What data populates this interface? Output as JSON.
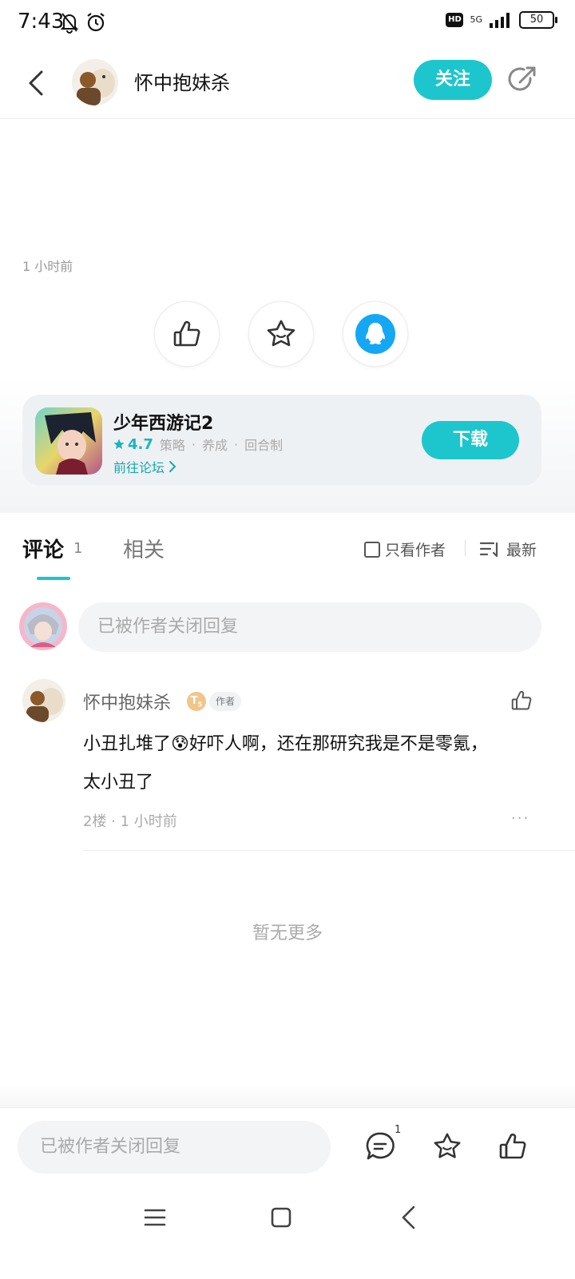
{
  "status_bar": {
    "time": "7:43",
    "network": "5G",
    "battery": "50",
    "hd": "HD"
  },
  "header": {
    "username": "怀中抱妹杀",
    "follow_label": "关注"
  },
  "post": {
    "timestamp": "1 小时前"
  },
  "game_card": {
    "title": "少年西游记2",
    "rating": "4.7",
    "tags": [
      "策略",
      "养成",
      "回合制"
    ],
    "forum_link": "前往论坛",
    "download_label": "下载"
  },
  "tabs": {
    "comments_label": "评论",
    "comments_count": "1",
    "related_label": "相关",
    "author_only_label": "只看作者",
    "sort_label": "最新"
  },
  "reply": {
    "placeholder": "已被作者关闭回复"
  },
  "comments": [
    {
      "author": "怀中抱妹杀",
      "level": "T",
      "level_num": "5",
      "author_tag": "作者",
      "text_lines": [
        "小丑扎堆了😰好吓人啊，还在那研究我是不是零氪，",
        "太小丑了"
      ],
      "meta": "2楼 · 1 小时前",
      "more": "···"
    }
  ],
  "footer": {
    "no_more": "暂无更多"
  },
  "bottom_bar": {
    "placeholder": "已被作者关闭回复",
    "comment_count": "1"
  },
  "colors": {
    "accent": "#1cc6cc",
    "link": "#12a8b3",
    "text": "#111111",
    "muted": "#aaaaaa"
  },
  "icons": [
    "back-icon",
    "share-icon",
    "like-icon",
    "star-icon",
    "qq-icon",
    "chevron-right-icon",
    "sort-icon",
    "comment-icon",
    "more-icon",
    "menu-icon",
    "home-icon",
    "nav-back-icon"
  ]
}
